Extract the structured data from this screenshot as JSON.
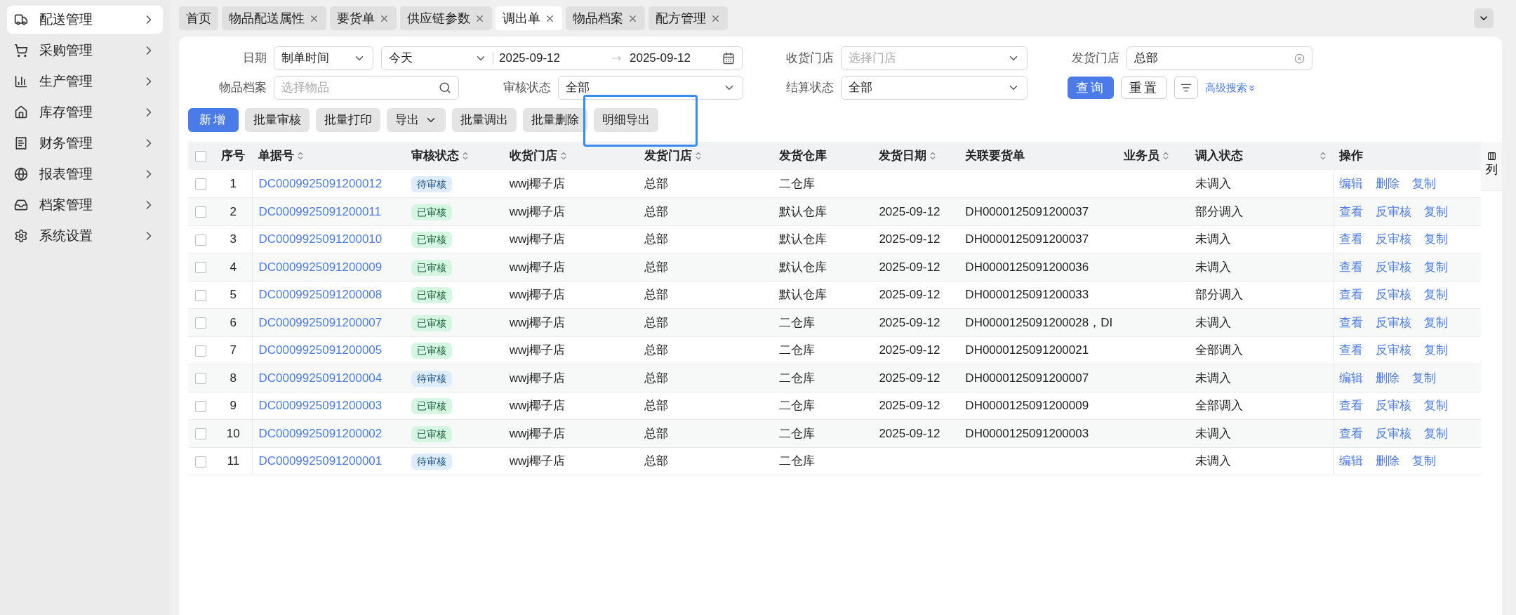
{
  "sidebar": {
    "items": [
      {
        "label": "配送管理",
        "selected": true
      },
      {
        "label": "采购管理",
        "selected": false
      },
      {
        "label": "生产管理",
        "selected": false
      },
      {
        "label": "库存管理",
        "selected": false
      },
      {
        "label": "财务管理",
        "selected": false
      },
      {
        "label": "报表管理",
        "selected": false
      },
      {
        "label": "档案管理",
        "selected": false
      },
      {
        "label": "系统设置",
        "selected": false
      }
    ]
  },
  "tabs": [
    {
      "label": "首页",
      "closable": false,
      "selected": false
    },
    {
      "label": "物品配送属性",
      "closable": true,
      "selected": false
    },
    {
      "label": "要货单",
      "closable": true,
      "selected": false
    },
    {
      "label": "供应链参数",
      "closable": true,
      "selected": false
    },
    {
      "label": "调出单",
      "closable": true,
      "selected": true
    },
    {
      "label": "物品档案",
      "closable": true,
      "selected": false
    },
    {
      "label": "配方管理",
      "closable": true,
      "selected": false
    }
  ],
  "filters": {
    "date": {
      "label": "日期",
      "type": "制单时间",
      "preset": "今天",
      "start": "2025-09-12",
      "end": "2025-09-12"
    },
    "receive_store": {
      "label": "收货门店",
      "placeholder": "选择门店"
    },
    "send_store": {
      "label": "发货门店",
      "value": "总部"
    },
    "item": {
      "label": "物品档案",
      "placeholder": "选择物品"
    },
    "review_status": {
      "label": "审核状态",
      "value": "全部"
    },
    "settle_status": {
      "label": "结算状态",
      "value": "全部"
    },
    "query": "查询",
    "reset": "重置",
    "advanced": "高级搜索"
  },
  "toolbar": [
    {
      "label": "新增",
      "kind": "primary",
      "highlighted": false
    },
    {
      "label": "批量审核",
      "kind": "plain",
      "highlighted": false
    },
    {
      "label": "批量打印",
      "kind": "plain",
      "highlighted": false
    },
    {
      "label": "导出",
      "kind": "dropdown",
      "highlighted": false
    },
    {
      "label": "批量调出",
      "kind": "plain",
      "highlighted": false
    },
    {
      "label": "批量删除",
      "kind": "plain",
      "highlighted": false
    },
    {
      "label": "明细导出",
      "kind": "plain",
      "highlighted": true
    }
  ],
  "table": {
    "all_checked": false,
    "columns": [
      {
        "label": "序号",
        "sortable": false
      },
      {
        "label": "单据号",
        "sortable": true
      },
      {
        "label": "审核状态",
        "sortable": true
      },
      {
        "label": "收货门店",
        "sortable": true
      },
      {
        "label": "发货门店",
        "sortable": true
      },
      {
        "label": "发货仓库",
        "sortable": false
      },
      {
        "label": "发货日期",
        "sortable": true
      },
      {
        "label": "关联要货单",
        "sortable": false
      },
      {
        "label": "业务员",
        "sortable": true
      },
      {
        "label": "调入状态",
        "sortable": true
      },
      {
        "label": "操作",
        "sortable": false
      }
    ],
    "column_button": "列",
    "rows": [
      {
        "no": "1",
        "checked": false,
        "id": "DC0009925091200012",
        "review": {
          "text": "待审核",
          "kind": "pending"
        },
        "to": "wwj椰子店",
        "from": "总部",
        "warehouse": "二仓库",
        "date": "",
        "req": "",
        "status": "未调入",
        "actions": [
          "编辑",
          "删除",
          "复制"
        ]
      },
      {
        "no": "2",
        "checked": false,
        "id": "DC0009925091200011",
        "review": {
          "text": "已审核",
          "kind": "approved"
        },
        "to": "wwj椰子店",
        "from": "总部",
        "warehouse": "默认仓库",
        "date": "2025-09-12",
        "req": "DH0000125091200037",
        "status": "部分调入",
        "actions": [
          "查看",
          "反审核",
          "复制"
        ]
      },
      {
        "no": "3",
        "checked": false,
        "id": "DC0009925091200010",
        "review": {
          "text": "已审核",
          "kind": "approved"
        },
        "to": "wwj椰子店",
        "from": "总部",
        "warehouse": "默认仓库",
        "date": "2025-09-12",
        "req": "DH0000125091200037",
        "status": "未调入",
        "actions": [
          "查看",
          "反审核",
          "复制"
        ]
      },
      {
        "no": "4",
        "checked": false,
        "id": "DC0009925091200009",
        "review": {
          "text": "已审核",
          "kind": "approved"
        },
        "to": "wwj椰子店",
        "from": "总部",
        "warehouse": "默认仓库",
        "date": "2025-09-12",
        "req": "DH0000125091200036",
        "status": "未调入",
        "actions": [
          "查看",
          "反审核",
          "复制"
        ]
      },
      {
        "no": "5",
        "checked": false,
        "id": "DC0009925091200008",
        "review": {
          "text": "已审核",
          "kind": "approved"
        },
        "to": "wwj椰子店",
        "from": "总部",
        "warehouse": "默认仓库",
        "date": "2025-09-12",
        "req": "DH0000125091200033",
        "status": "部分调入",
        "actions": [
          "查看",
          "反审核",
          "复制"
        ]
      },
      {
        "no": "6",
        "checked": false,
        "id": "DC0009925091200007",
        "review": {
          "text": "已审核",
          "kind": "approved"
        },
        "to": "wwj椰子店",
        "from": "总部",
        "warehouse": "二仓库",
        "date": "2025-09-12",
        "req": "DH0000125091200028，DI",
        "status": "未调入",
        "actions": [
          "查看",
          "反审核",
          "复制"
        ]
      },
      {
        "no": "7",
        "checked": false,
        "id": "DC0009925091200005",
        "review": {
          "text": "已审核",
          "kind": "approved"
        },
        "to": "wwj椰子店",
        "from": "总部",
        "warehouse": "二仓库",
        "date": "2025-09-12",
        "req": "DH0000125091200021",
        "status": "全部调入",
        "actions": [
          "查看",
          "反审核",
          "复制"
        ]
      },
      {
        "no": "8",
        "checked": false,
        "id": "DC0009925091200004",
        "review": {
          "text": "待审核",
          "kind": "pending"
        },
        "to": "wwj椰子店",
        "from": "总部",
        "warehouse": "二仓库",
        "date": "2025-09-12",
        "req": "DH0000125091200007",
        "status": "未调入",
        "actions": [
          "编辑",
          "删除",
          "复制"
        ]
      },
      {
        "no": "9",
        "checked": false,
        "id": "DC0009925091200003",
        "review": {
          "text": "已审核",
          "kind": "approved"
        },
        "to": "wwj椰子店",
        "from": "总部",
        "warehouse": "二仓库",
        "date": "2025-09-12",
        "req": "DH0000125091200009",
        "status": "全部调入",
        "actions": [
          "查看",
          "反审核",
          "复制"
        ]
      },
      {
        "no": "10",
        "checked": false,
        "id": "DC0009925091200002",
        "review": {
          "text": "已审核",
          "kind": "approved"
        },
        "to": "wwj椰子店",
        "from": "总部",
        "warehouse": "二仓库",
        "date": "2025-09-12",
        "req": "DH0000125091200003",
        "status": "未调入",
        "actions": [
          "查看",
          "反审核",
          "复制"
        ]
      },
      {
        "no": "11",
        "checked": false,
        "id": "DC0009925091200001",
        "review": {
          "text": "待审核",
          "kind": "pending"
        },
        "to": "wwj椰子店",
        "from": "总部",
        "warehouse": "二仓库",
        "date": "",
        "req": "",
        "status": "未调入",
        "actions": [
          "编辑",
          "删除",
          "复制"
        ]
      }
    ]
  }
}
